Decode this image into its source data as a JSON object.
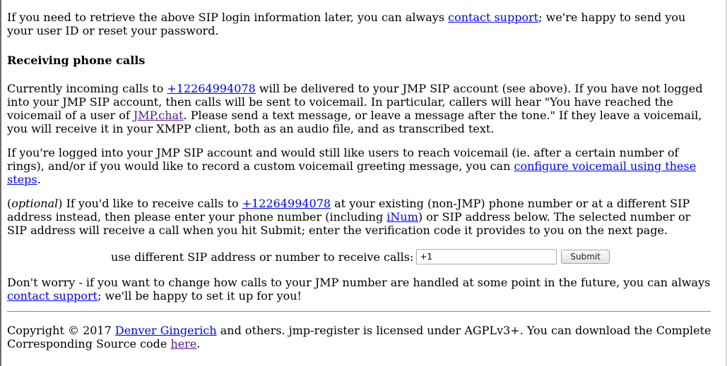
{
  "intro": {
    "before_link": "If you need to retrieve the above SIP login information later, you can always ",
    "contact_support_link": "contact support",
    "after_link": "; we're happy to send you your user ID or reset your password."
  },
  "receiving": {
    "heading": "Receiving phone calls",
    "p1": {
      "t1": "Currently incoming calls to ",
      "number_link": "+12264994078",
      "t2": " will be delivered to your JMP SIP account (see above). If you have not logged into your JMP SIP account, then calls will be sent to voicemail. In particular, callers will hear \"You have reached the voicemail of a user of ",
      "jmp_link": "JMP.chat",
      "t3": ". Please send a text message, or leave a message after the tone.\" If they leave a voicemail, you will receive it in your XMPP client, both as an audio file, and as transcribed text."
    },
    "p2": {
      "t1": "If you're logged into your JMP SIP account and would still like users to reach voicemail (ie. after a certain number of rings), and/or if you would like to record a custom voicemail greeting message, you can ",
      "voicemail_link": "configure voicemail using these steps",
      "t2": "."
    },
    "p3": {
      "optional": "optional",
      "t0": "(",
      "t1": ") If you'd like to receive calls to ",
      "number_link": "+12264994078",
      "t2": " at your existing (non-JMP) phone number or at a different SIP address instead, then please enter your phone number (including ",
      "inum_link": "iNum",
      "t3": ") or SIP address below. The selected number or SIP address will receive a call when you hit Submit; enter the verification code it provides to you on the next page."
    },
    "form": {
      "label": "use different SIP address or number to receive calls:",
      "input_value": "+1",
      "submit_label": "Submit"
    },
    "p4": {
      "t1": "Don't worry - if you want to change how calls to your JMP number are handled at some point in the future, you can always ",
      "contact_support_link": "contact support",
      "t2": "; we'll be happy to set it up for you!"
    }
  },
  "footer": {
    "t1": "Copyright © 2017 ",
    "author_link": "Denver Gingerich",
    "t2": " and others. jmp-register is licensed under AGPLv3+. You can download the Complete Corresponding Source code ",
    "here_link": "here",
    "t3": "."
  },
  "colors": {
    "link": "#0000ee",
    "visited_link": "#551a8b",
    "text": "#000000",
    "background": "#ffffff"
  }
}
